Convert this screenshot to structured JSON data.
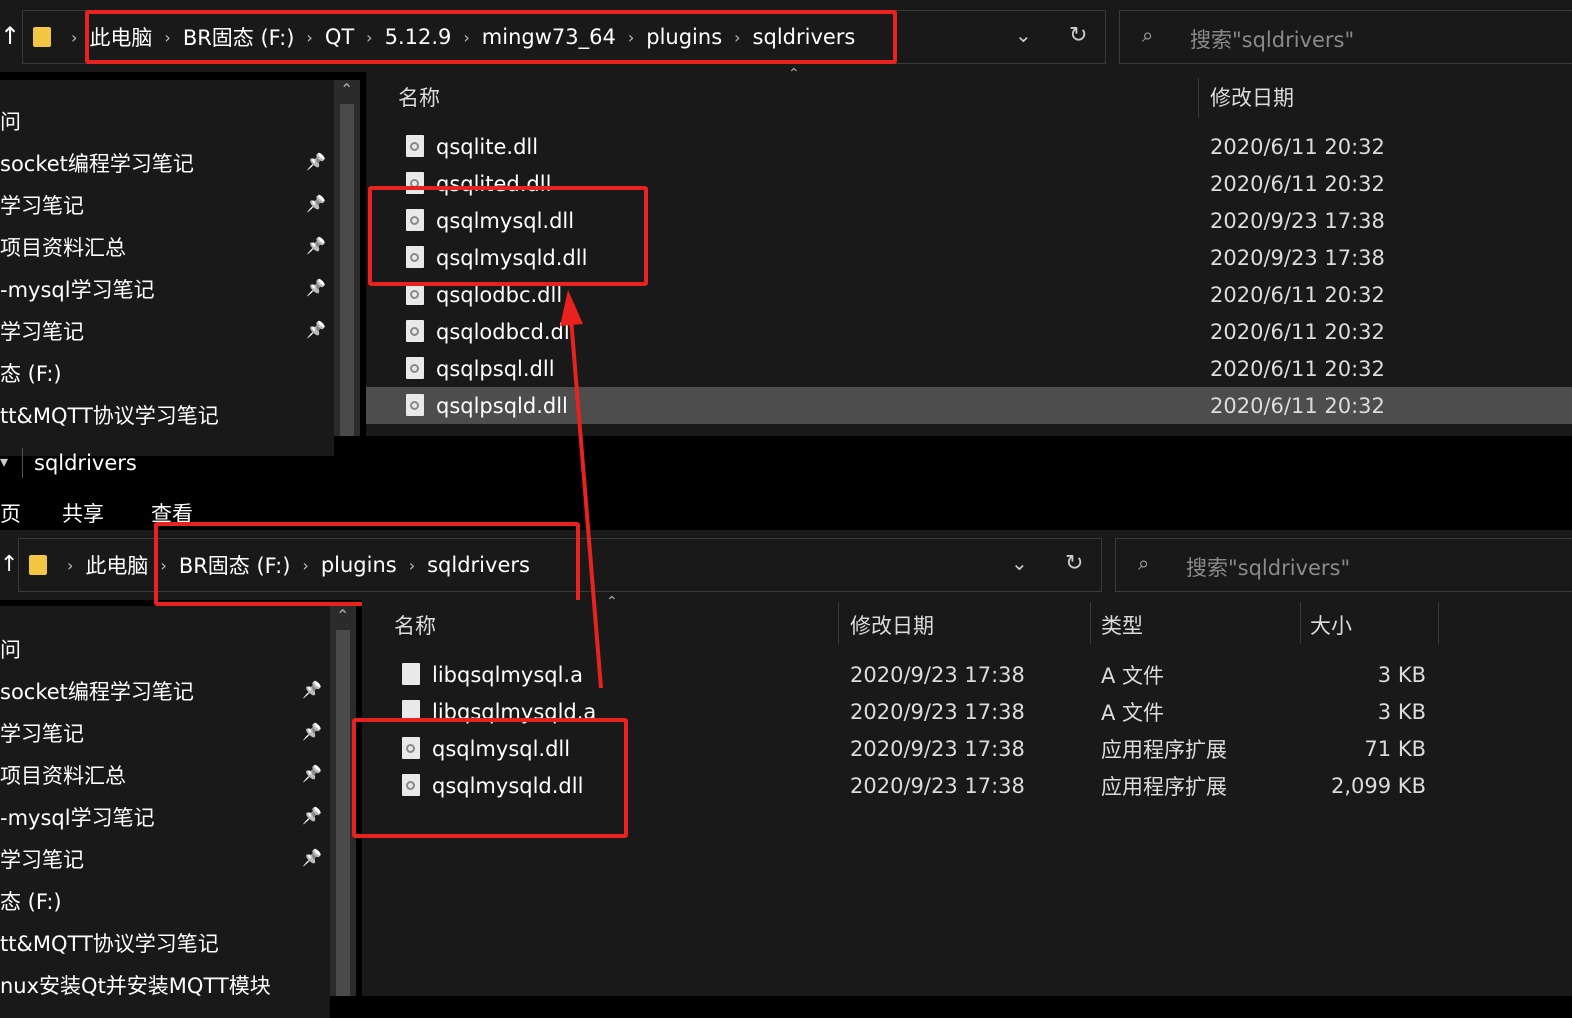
{
  "top": {
    "breadcrumb": [
      "此电脑",
      "BR固态 (F:)",
      "QT",
      "5.12.9",
      "mingw73_64",
      "plugins",
      "sqldrivers"
    ],
    "search_placeholder": "搜索\"sqldrivers\"",
    "columns": {
      "name": "名称",
      "date": "修改日期"
    },
    "nav": [
      {
        "label": "问",
        "pinned": false
      },
      {
        "label": "socket编程学习笔记",
        "pinned": true
      },
      {
        "label": "学习笔记",
        "pinned": true
      },
      {
        "label": "项目资料汇总",
        "pinned": true
      },
      {
        "label": "-mysql学习笔记",
        "pinned": true
      },
      {
        "label": "学习笔记",
        "pinned": true
      },
      {
        "label": "态 (F:)",
        "pinned": false
      },
      {
        "label": "tt&MQTT协议学习笔记",
        "pinned": false
      }
    ],
    "files": [
      {
        "name": "qsqlite.dll",
        "date": "2020/6/11 20:32"
      },
      {
        "name": "qsqlited.dll",
        "date": "2020/6/11 20:32"
      },
      {
        "name": "qsqlmysql.dll",
        "date": "2020/9/23 17:38"
      },
      {
        "name": "qsqlmysqld.dll",
        "date": "2020/9/23 17:38"
      },
      {
        "name": "qsqlodbc.dll",
        "date": "2020/6/11 20:32"
      },
      {
        "name": "qsqlodbcd.dll",
        "date": "2020/6/11 20:32"
      },
      {
        "name": "qsqlpsql.dll",
        "date": "2020/6/11 20:32"
      },
      {
        "name": "qsqlpsqld.dll",
        "date": "2020/6/11 20:32"
      }
    ],
    "selected_index": 7
  },
  "bottom": {
    "window_title": "sqldrivers",
    "ribbon_tabs": [
      "页",
      "共享",
      "查看"
    ],
    "breadcrumb": [
      "此电脑",
      "BR固态 (F:)",
      "plugins",
      "sqldrivers"
    ],
    "search_placeholder": "搜索\"sqldrivers\"",
    "columns": {
      "name": "名称",
      "date": "修改日期",
      "type": "类型",
      "size": "大小"
    },
    "nav": [
      {
        "label": "问",
        "pinned": false
      },
      {
        "label": "socket编程学习笔记",
        "pinned": true
      },
      {
        "label": "学习笔记",
        "pinned": true
      },
      {
        "label": "项目资料汇总",
        "pinned": true
      },
      {
        "label": "-mysql学习笔记",
        "pinned": true
      },
      {
        "label": "学习笔记",
        "pinned": true
      },
      {
        "label": "态 (F:)",
        "pinned": false
      },
      {
        "label": "tt&MQTT协议学习笔记",
        "pinned": false
      },
      {
        "label": "nux安装Qt并安装MQTT模块",
        "pinned": false
      }
    ],
    "files": [
      {
        "name": "libqsqlmysql.a",
        "date": "2020/9/23 17:38",
        "type": "A 文件",
        "size": "3 KB",
        "icon": "file-icon"
      },
      {
        "name": "libqsqlmysqld.a",
        "date": "2020/9/23 17:38",
        "type": "A 文件",
        "size": "3 KB",
        "icon": "file-icon"
      },
      {
        "name": "qsqlmysql.dll",
        "date": "2020/9/23 17:38",
        "type": "应用程序扩展",
        "size": "71 KB",
        "icon": "dll-icon"
      },
      {
        "name": "qsqlmysqld.dll",
        "date": "2020/9/23 17:38",
        "type": "应用程序扩展",
        "size": "2,099 KB",
        "icon": "dll-icon"
      }
    ]
  },
  "colors": {
    "annotation": "#e8231f",
    "background": "#191919",
    "selected_row": "#4d4d4d"
  }
}
